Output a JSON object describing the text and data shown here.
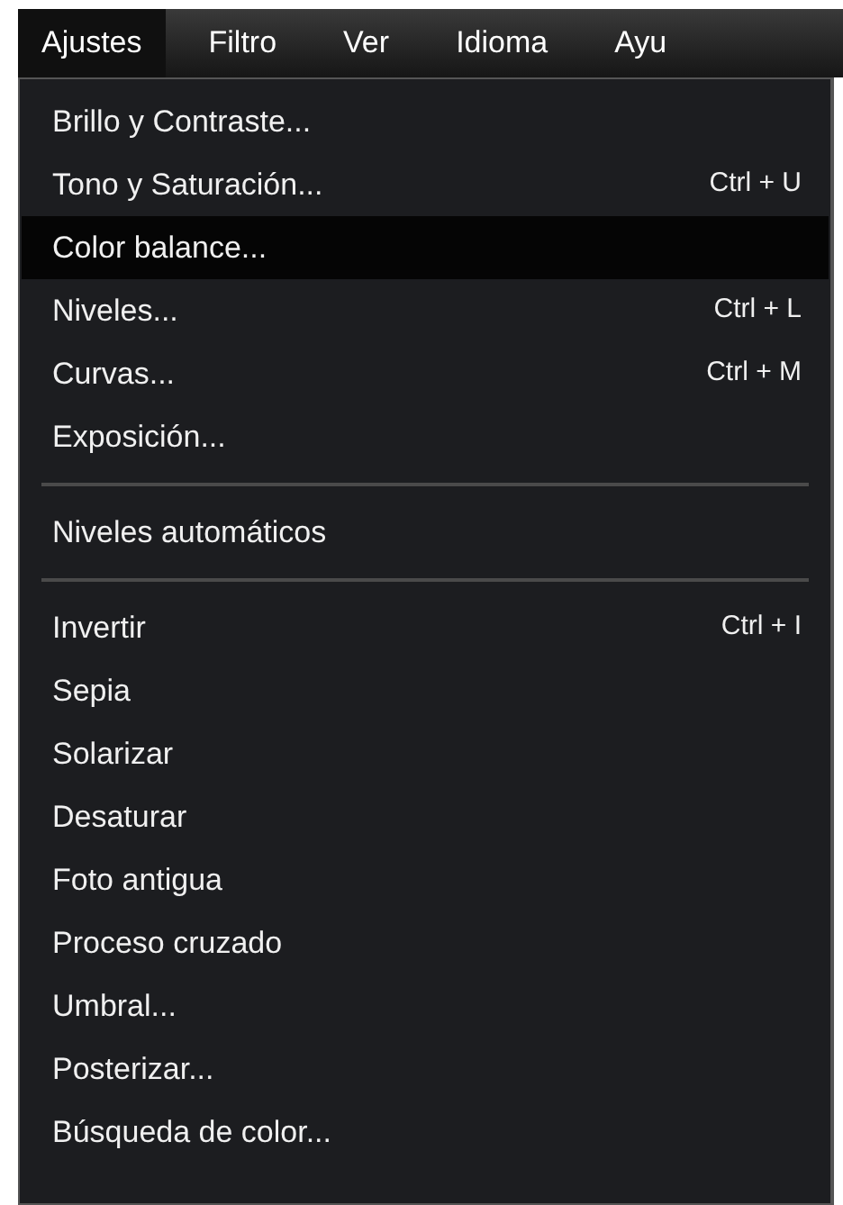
{
  "menubar": [
    {
      "label": "Ajustes",
      "selected": true
    },
    {
      "label": "Filtro",
      "selected": false
    },
    {
      "label": "Ver",
      "selected": false
    },
    {
      "label": "Idioma",
      "selected": false
    },
    {
      "label": "Ayu",
      "selected": false
    }
  ],
  "menu": {
    "items": [
      {
        "kind": "item",
        "label": "Brillo y Contraste...",
        "selected": false
      },
      {
        "kind": "item",
        "label": "Tono y Saturación...",
        "shortcut": "Ctrl + U",
        "selected": false
      },
      {
        "kind": "item",
        "label": "Color balance...",
        "selected": true
      },
      {
        "kind": "item",
        "label": "Niveles...",
        "shortcut": "Ctrl + L",
        "selected": false
      },
      {
        "kind": "item",
        "label": "Curvas...",
        "shortcut": "Ctrl + M",
        "selected": false
      },
      {
        "kind": "item",
        "label": "Exposición...",
        "selected": false
      },
      {
        "kind": "separator"
      },
      {
        "kind": "item",
        "label": "Niveles automáticos",
        "selected": false
      },
      {
        "kind": "separator"
      },
      {
        "kind": "item",
        "label": "Invertir",
        "shortcut": "Ctrl + I",
        "selected": false
      },
      {
        "kind": "item",
        "label": "Sepia",
        "selected": false
      },
      {
        "kind": "item",
        "label": "Solarizar",
        "selected": false
      },
      {
        "kind": "item",
        "label": "Desaturar",
        "selected": false
      },
      {
        "kind": "item",
        "label": "Foto antigua",
        "selected": false
      },
      {
        "kind": "item",
        "label": "Proceso cruzado",
        "selected": false
      },
      {
        "kind": "item",
        "label": "Umbral...",
        "selected": false
      },
      {
        "kind": "item",
        "label": "Posterizar...",
        "selected": false
      },
      {
        "kind": "item",
        "label": "Búsqueda de color...",
        "selected": false
      }
    ]
  }
}
